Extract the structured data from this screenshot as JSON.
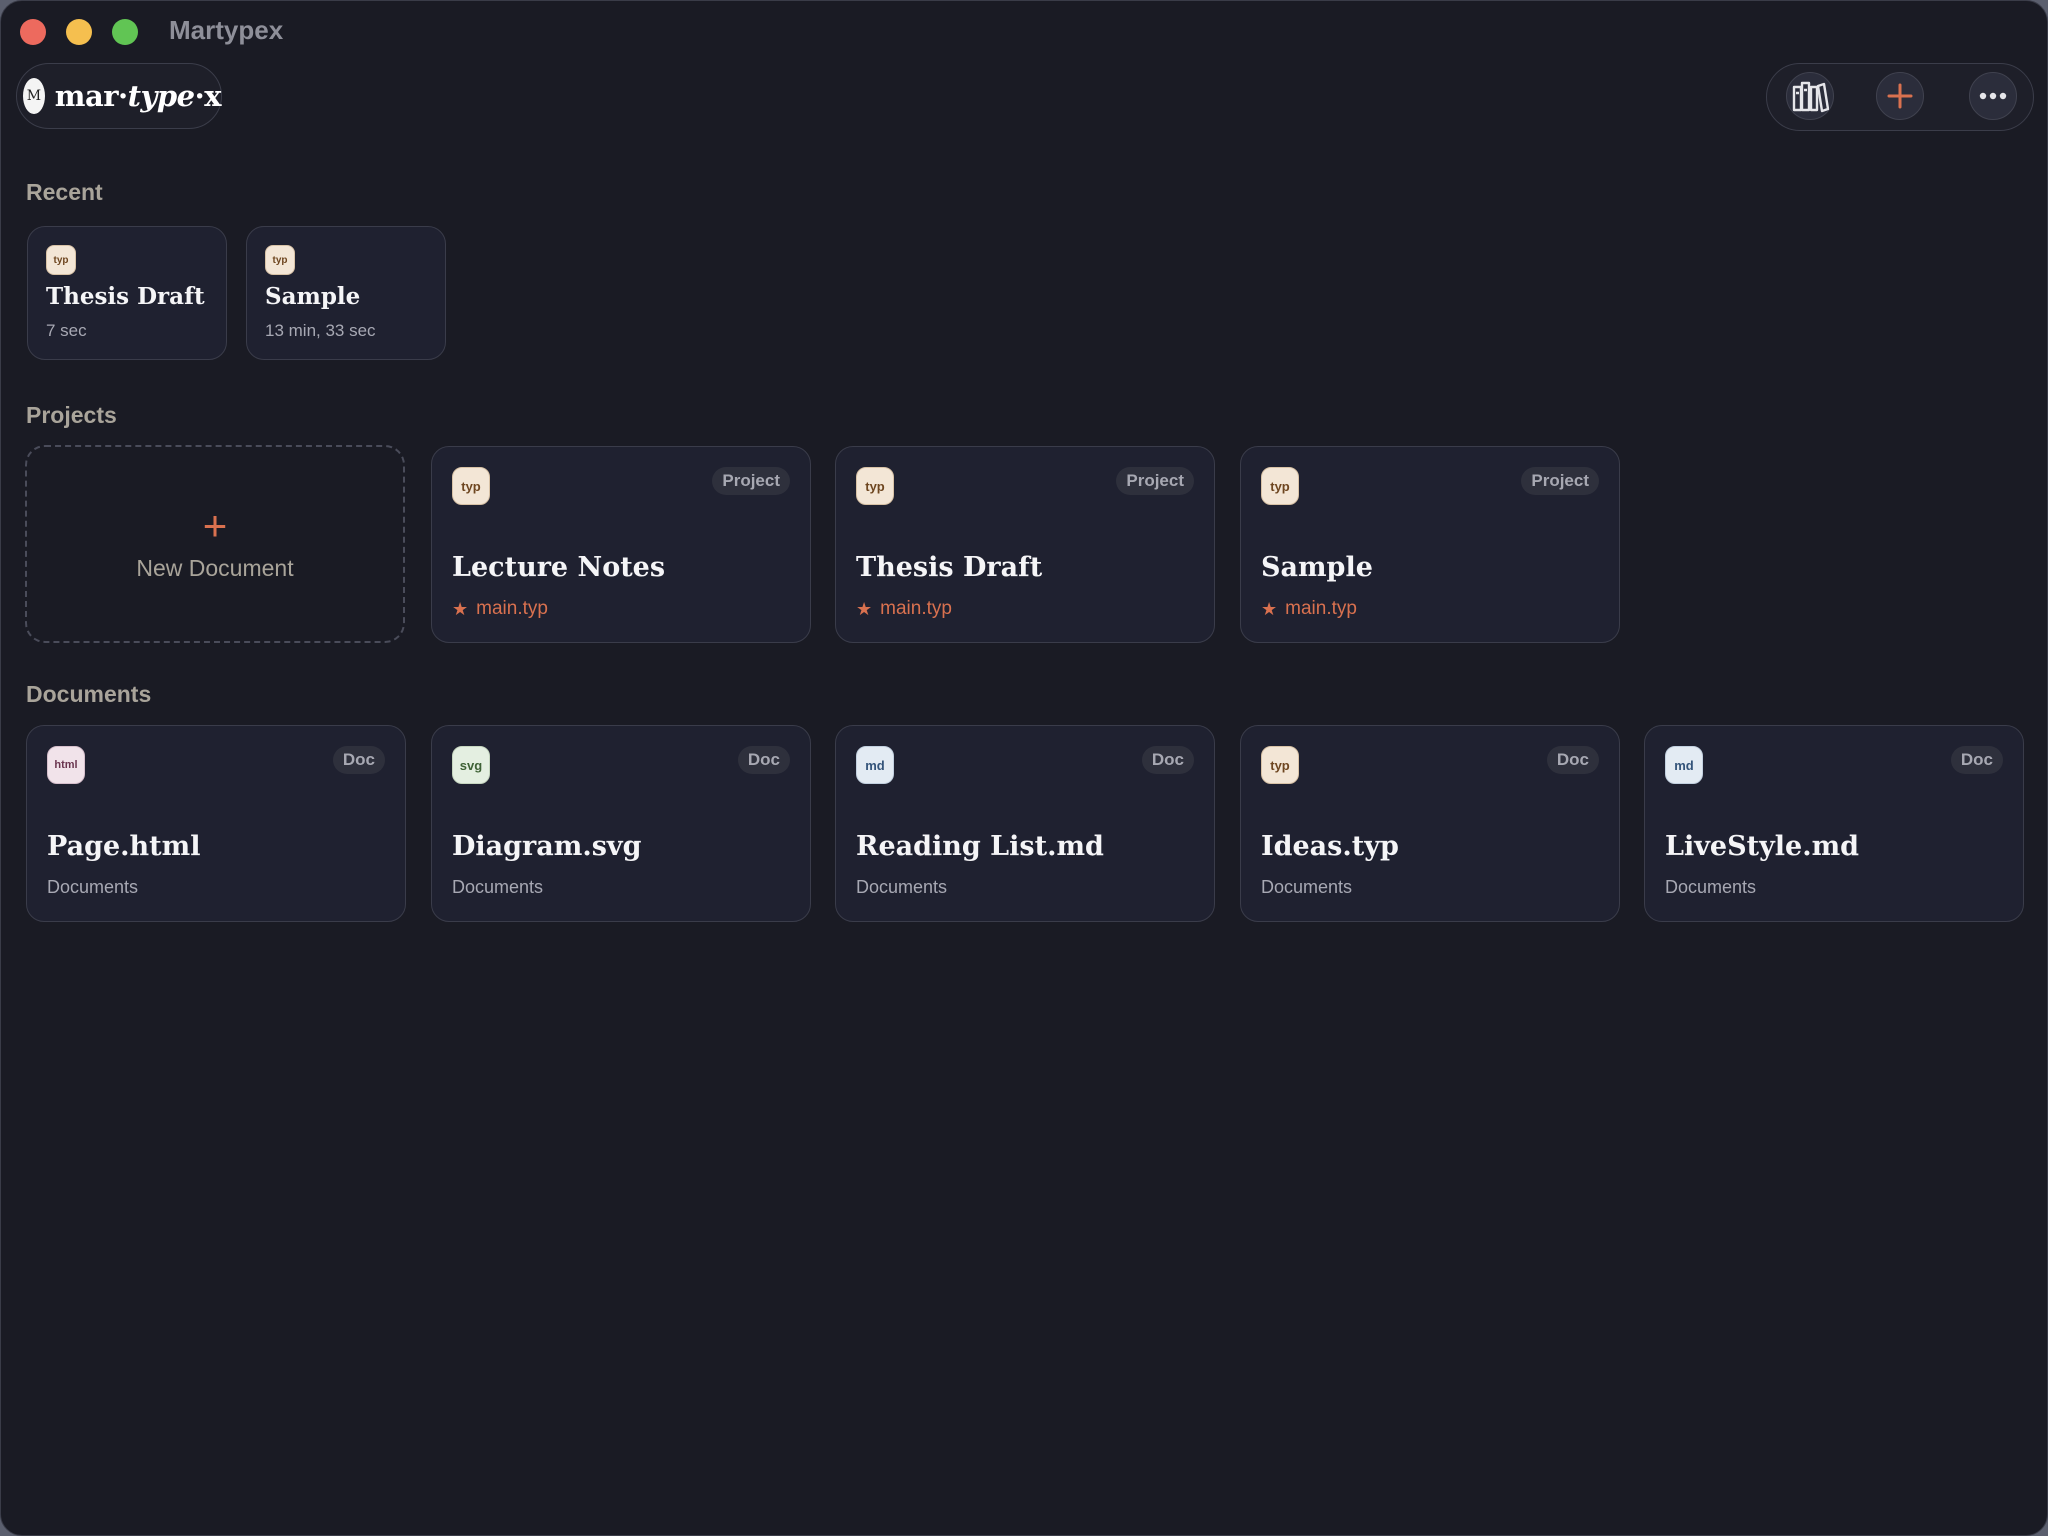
{
  "window": {
    "title": "Martypex"
  },
  "logo": {
    "mark": "M",
    "text_main": "mar·",
    "text_italic": "type",
    "text_tail": "·x"
  },
  "toolbar": {
    "library_icon": "library-icon",
    "add_icon": "plus-icon",
    "more_icon": "ellipsis-icon"
  },
  "colors": {
    "background": "#1a1b24",
    "card": "#1f2130",
    "accent": "#d9714f",
    "section_title": "#a9a49a"
  },
  "recent": {
    "title": "Recent",
    "items": [
      {
        "icon": "typ",
        "name": "Thesis Draft",
        "time": "7 sec"
      },
      {
        "icon": "typ",
        "name": "Sample",
        "time": "13 min, 33 sec"
      }
    ]
  },
  "projects": {
    "title": "Projects",
    "new_document": {
      "icon": "+",
      "label": "New Document"
    },
    "items": [
      {
        "icon": "typ",
        "badge": "Project",
        "name": "Lecture Notes",
        "main_file": "main.typ"
      },
      {
        "icon": "typ",
        "badge": "Project",
        "name": "Thesis Draft",
        "main_file": "main.typ"
      },
      {
        "icon": "typ",
        "badge": "Project",
        "name": "Sample",
        "main_file": "main.typ"
      }
    ]
  },
  "documents": {
    "title": "Documents",
    "items": [
      {
        "icon": "html",
        "badge": "Doc",
        "name": "Page.html",
        "folder": "Documents"
      },
      {
        "icon": "svg",
        "badge": "Doc",
        "name": "Diagram.svg",
        "folder": "Documents"
      },
      {
        "icon": "md",
        "badge": "Doc",
        "name": "Reading List.md",
        "folder": "Documents"
      },
      {
        "icon": "typ",
        "badge": "Doc",
        "name": "Ideas.typ",
        "folder": "Documents"
      },
      {
        "icon": "md",
        "badge": "Doc",
        "name": "LiveStyle.md",
        "folder": "Documents"
      }
    ]
  }
}
